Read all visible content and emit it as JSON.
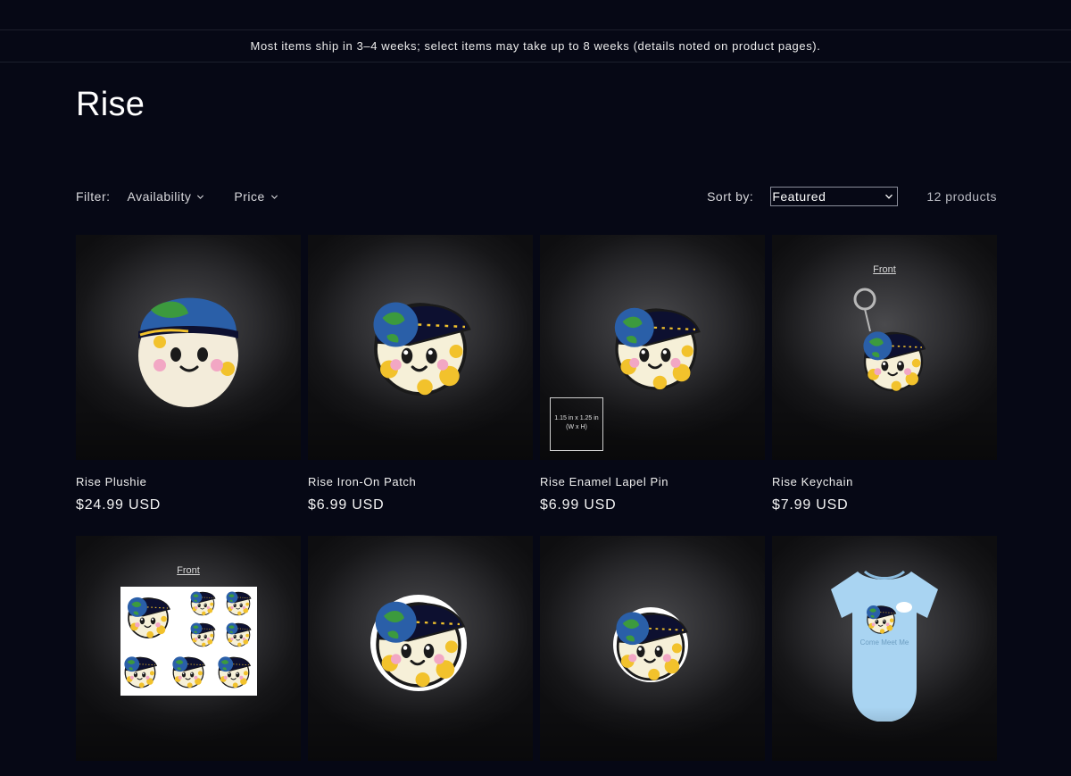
{
  "announcement": "Most items ship in 3–4 weeks; select items may take up to 8 weeks (details noted on product pages).",
  "collection": {
    "title": "Rise"
  },
  "filters": {
    "label": "Filter:",
    "facets": [
      {
        "label": "Availability",
        "icon": "chevron-down-icon"
      },
      {
        "label": "Price",
        "icon": "chevron-down-icon"
      }
    ]
  },
  "sort": {
    "label": "Sort by:",
    "selected": "Featured"
  },
  "product_count": "12 products",
  "products": [
    {
      "name": "Rise Plushie",
      "price": "$24.99 USD"
    },
    {
      "name": "Rise Iron-On Patch",
      "price": "$6.99 USD"
    },
    {
      "name": "Rise Enamel Lapel Pin",
      "price": "$6.99 USD",
      "dimension_text_1": "1.15 in x 1.25 in",
      "dimension_text_2": "(W x H)"
    },
    {
      "name": "Rise Keychain",
      "price": "$7.99 USD",
      "image_label": "Front"
    },
    {
      "name": "",
      "price": "",
      "image_label": "Front"
    },
    {
      "name": "",
      "price": ""
    },
    {
      "name": "",
      "price": ""
    },
    {
      "name": "",
      "price": "",
      "image_text": "Come Meet Me"
    }
  ],
  "colors": {
    "background": "#060815",
    "cap_blue": "#2a5fa8",
    "cap_green": "#3c9a3e",
    "spot_yellow": "#f2c22c",
    "cheek_pink": "#f2a7c4",
    "onesie_blue": "#a9d4f2"
  }
}
